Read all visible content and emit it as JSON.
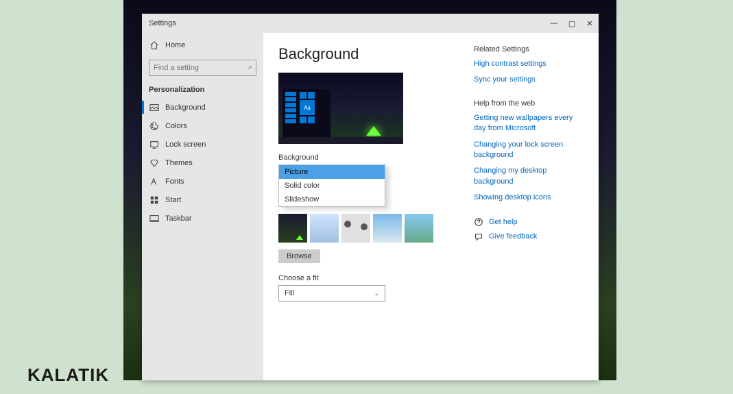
{
  "brand": "KALATIK",
  "window": {
    "title": "Settings",
    "controls": {
      "min": "—",
      "max": "▢",
      "close": "✕"
    }
  },
  "sidebar": {
    "home": "Home",
    "search_placeholder": "Find a setting",
    "section": "Personalization",
    "items": [
      {
        "label": "Background",
        "icon": "image-icon",
        "active": true
      },
      {
        "label": "Colors",
        "icon": "palette-icon"
      },
      {
        "label": "Lock screen",
        "icon": "lock-screen-icon"
      },
      {
        "label": "Themes",
        "icon": "themes-icon"
      },
      {
        "label": "Fonts",
        "icon": "fonts-icon"
      },
      {
        "label": "Start",
        "icon": "start-icon"
      },
      {
        "label": "Taskbar",
        "icon": "taskbar-icon"
      }
    ]
  },
  "main": {
    "title": "Background",
    "preview_sample": "Aa",
    "bg_label": "Background",
    "dropdown": {
      "selected": "Picture",
      "options": [
        "Picture",
        "Solid color",
        "Slideshow"
      ]
    },
    "browse": "Browse",
    "fit_label": "Choose a fit",
    "fit_value": "Fill"
  },
  "right": {
    "related_header": "Related Settings",
    "related_links": [
      "High contrast settings",
      "Sync your settings"
    ],
    "help_header": "Help from the web",
    "help_links": [
      "Getting new wallpapers every day from Microsoft",
      "Changing your lock screen background",
      "Changing my desktop background",
      "Showing desktop icons"
    ],
    "get_help": "Get help",
    "feedback": "Give feedback"
  }
}
